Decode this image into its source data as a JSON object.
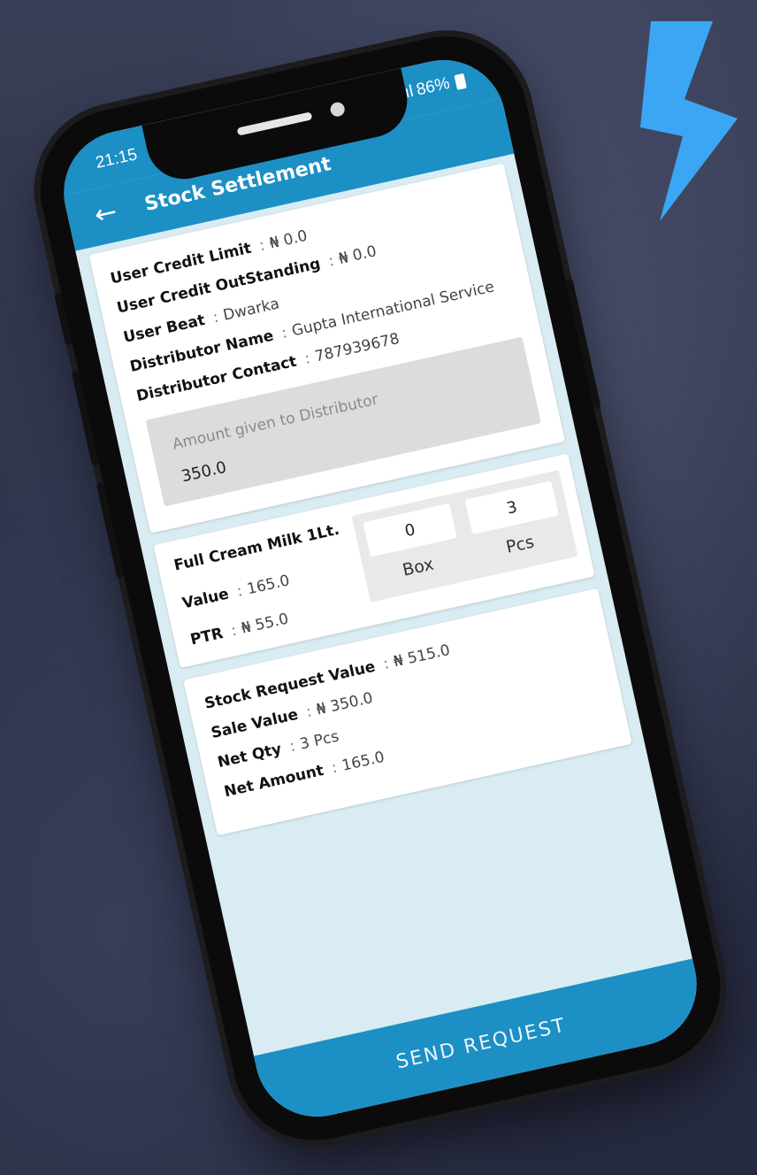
{
  "colors": {
    "primary": "#1c8fc4",
    "accent_bolt": "#3aa6f4",
    "screen_bg": "#d9ecf3"
  },
  "decor": {
    "icon": "lightning-bolt-icon"
  },
  "status_bar": {
    "time": "21:15",
    "signal": ".ıl",
    "battery": "86%"
  },
  "app_bar": {
    "back_icon": "arrow-left-icon",
    "title": "Stock Settlement"
  },
  "user_info": {
    "credit_limit": {
      "label": "User Credit Limit",
      "value": "₦ 0.0"
    },
    "credit_outstanding": {
      "label": "User Credit OutStanding",
      "value": "₦ 0.0"
    },
    "beat": {
      "label": "User Beat",
      "value": "Dwarka"
    },
    "distributor_name": {
      "label": "Distributor Name",
      "value": "Gupta International Service"
    },
    "distributor_contact": {
      "label": "Distributor Contact",
      "value": "787939678"
    },
    "amount_field": {
      "label": "Amount given to Distributor",
      "value": "350.0"
    }
  },
  "product": {
    "name": "Full Cream Milk 1Lt.",
    "value": {
      "label": "Value",
      "value": "165.0"
    },
    "ptr": {
      "label": "PTR",
      "value": "₦ 55.0"
    },
    "box": {
      "qty": "0",
      "unit": "Box"
    },
    "pcs": {
      "qty": "3",
      "unit": "Pcs"
    }
  },
  "summary": {
    "stock_request_value": {
      "label": "Stock Request Value",
      "value": "₦ 515.0"
    },
    "sale_value": {
      "label": "Sale Value",
      "value": "₦ 350.0"
    },
    "net_qty": {
      "label": "Net Qty",
      "value": "3 Pcs"
    },
    "net_amount": {
      "label": "Net Amount",
      "value": "165.0"
    }
  },
  "footer": {
    "send_label": "SEND REQUEST"
  }
}
